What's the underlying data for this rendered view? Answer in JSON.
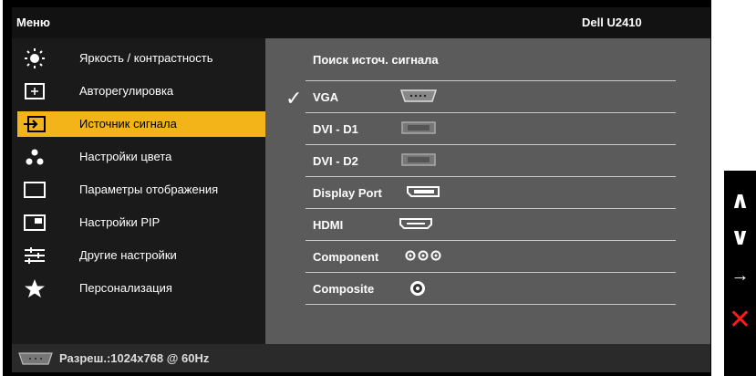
{
  "header": {
    "title": "Меню",
    "model": "Dell U2410"
  },
  "menu": [
    {
      "label": "Яркость / контрастность",
      "icon": "brightness-icon",
      "active": false
    },
    {
      "label": "Авторегулировка",
      "icon": "auto-adjust-icon",
      "active": false
    },
    {
      "label": "Источник сигнала",
      "icon": "input-source-icon",
      "active": true
    },
    {
      "label": "Настройки цвета",
      "icon": "color-settings-icon",
      "active": false
    },
    {
      "label": "Параметры отображения",
      "icon": "display-settings-icon",
      "active": false
    },
    {
      "label": "Настройки PIP",
      "icon": "pip-icon",
      "active": false
    },
    {
      "label": "Другие настройки",
      "icon": "other-settings-icon",
      "active": false
    },
    {
      "label": "Персонализация",
      "icon": "star-icon",
      "active": false
    }
  ],
  "panel": {
    "title": "Поиск источ. сигнала",
    "sources": [
      {
        "label": "VGA",
        "connector": "vga-connector-icon",
        "selected": true
      },
      {
        "label": "DVI - D1",
        "connector": "dvi-connector-icon",
        "selected": false
      },
      {
        "label": "DVI - D2",
        "connector": "dvi-connector-icon",
        "selected": false
      },
      {
        "label": "Display Port",
        "connector": "displayport-connector-icon",
        "selected": false
      },
      {
        "label": "HDMI",
        "connector": "hdmi-connector-icon",
        "selected": false
      },
      {
        "label": "Component",
        "connector": "component-connector-icon",
        "selected": false
      },
      {
        "label": "Composite",
        "connector": "composite-connector-icon",
        "selected": false
      }
    ]
  },
  "status": {
    "resolution": "Разреш.:1024x768 @ 60Hz"
  },
  "side_buttons": {
    "up": "∧",
    "down": "∨",
    "enter": "→",
    "exit": "✕"
  },
  "colors": {
    "accent": "#f2b418",
    "exit": "#ff1a1a"
  }
}
